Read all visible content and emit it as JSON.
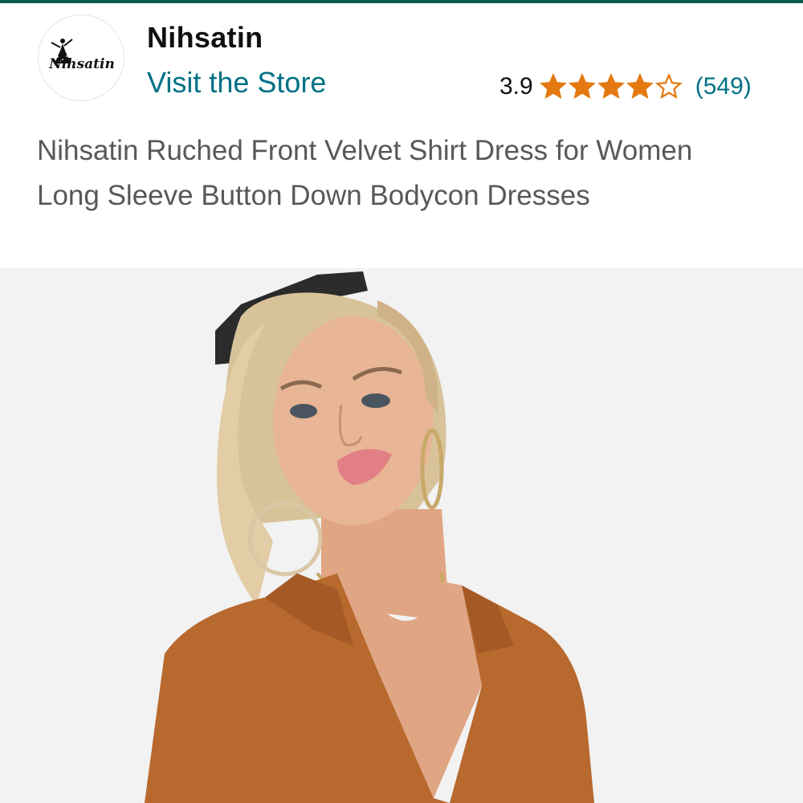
{
  "brand": {
    "name": "Nihsatin",
    "logo_text": "Nihsatin",
    "visit_store_label": "Visit the Store"
  },
  "rating": {
    "value": "3.9",
    "stars_filled": 3.9,
    "stars_max": 5,
    "review_count": "(549)"
  },
  "product": {
    "title": "Nihsatin Ruched Front Velvet Shirt Dress for Women Long Sleeve Button Down Bodycon Dresses"
  },
  "colors": {
    "accent_strip": "#0d5c4a",
    "link": "#007185",
    "star": "#e47911",
    "title_text": "#565959"
  },
  "icons": {
    "star": "star-icon",
    "logo": "dancer-silhouette-icon"
  }
}
